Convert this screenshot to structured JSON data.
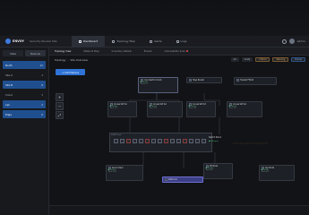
{
  "app": {
    "name": "ENVOY",
    "workspace": "Security Review Site"
  },
  "nav": {
    "items": [
      "Dashboard",
      "Topology Map",
      "Alerts",
      "Logs"
    ],
    "user": "admin"
  },
  "sidebar": {
    "buttons": [
      "Sites",
      "Devices"
    ],
    "items": [
      {
        "label": "North",
        "count": "12"
      },
      {
        "label": "Site A",
        "count": "4"
      },
      {
        "label": "Site B",
        "count": "8"
      },
      {
        "label": "Cloud",
        "count": "3"
      },
      {
        "label": "Lab",
        "count": "2"
      },
      {
        "label": "Edge",
        "count": "6"
      }
    ]
  },
  "toolbar": {
    "tabs": [
      "Topology View",
      "Network Map",
      "Inventory Details",
      "Events",
      "Vulnerability Scan"
    ]
  },
  "subbar": {
    "crumbs": [
      "Topology",
      "Site Overview"
    ]
  },
  "filters": {
    "chips": [
      "All",
      "VLAN",
      "Critical",
      "Warning",
      "Online"
    ]
  },
  "actions": {
    "add_device": "+ Add Device"
  },
  "zoom": {
    "in": "+",
    "out": "−",
    "fit": "⤢"
  },
  "nodes": [
    {
      "title": "Core Switch CS-01",
      "status": "● Online",
      "sub": "10.0.0.1"
    },
    {
      "title": "Edge Router",
      "status": "● Online",
      "sub": "10.0.0.254"
    },
    {
      "title": "Access SW A1",
      "status": "● Online",
      "sub": "10.0.1.2"
    },
    {
      "title": "Access SW A2",
      "status": "● Online",
      "sub": "10.0.1.3"
    },
    {
      "title": "Access SW A3",
      "status": "● Online",
      "sub": "10.0.1.4"
    },
    {
      "title": "Access SW A4",
      "status": "● Online",
      "sub": "10.0.1.5"
    },
    {
      "title": "Firewall FW-01",
      "status": "● Online",
      "sub": "10.0.2.1"
    },
    {
      "title": "Server Rack",
      "status": "● Online",
      "sub": "10.0.3.10"
    },
    {
      "title": "WAN Link",
      "status": "",
      "sub": ""
    },
    {
      "title": "DB Node",
      "status": "● Online",
      "sub": "10.0.4.2"
    },
    {
      "title": "App Node",
      "status": "● Online",
      "sub": "10.0.4.3"
    }
  ],
  "vlan": {
    "label": "VLAN Trunk",
    "side_title": "Switch Stack",
    "side_status": "● 24 ports"
  }
}
